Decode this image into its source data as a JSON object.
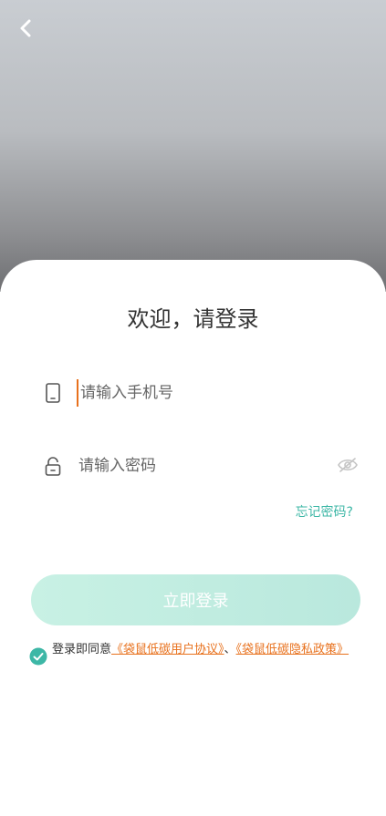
{
  "colors": {
    "accent_orange": "#e8711d",
    "accent_teal": "#3db7a6",
    "login_button_start": "#c8f1e4",
    "login_button_end": "#b9e8dd"
  },
  "header": {
    "back_icon": "chevron-left-icon",
    "hero_image": "illustration-car-and-character"
  },
  "login": {
    "title": "欢迎，请登录",
    "phone": {
      "icon": "phone-icon",
      "placeholder": "请输入手机号",
      "value": ""
    },
    "password": {
      "icon": "lock-icon",
      "placeholder": "请输入密码",
      "value": "",
      "toggle_icon": "eye-off-icon"
    },
    "forgot_label": "忘记密码?",
    "submit_label": "立即登录"
  },
  "agreement": {
    "checked": true,
    "prefix": "登录即同意",
    "user_agreement": "《袋鼠低碳用户协议》",
    "separator": "、",
    "privacy_policy": "《袋鼠低碳隐私政策》"
  }
}
